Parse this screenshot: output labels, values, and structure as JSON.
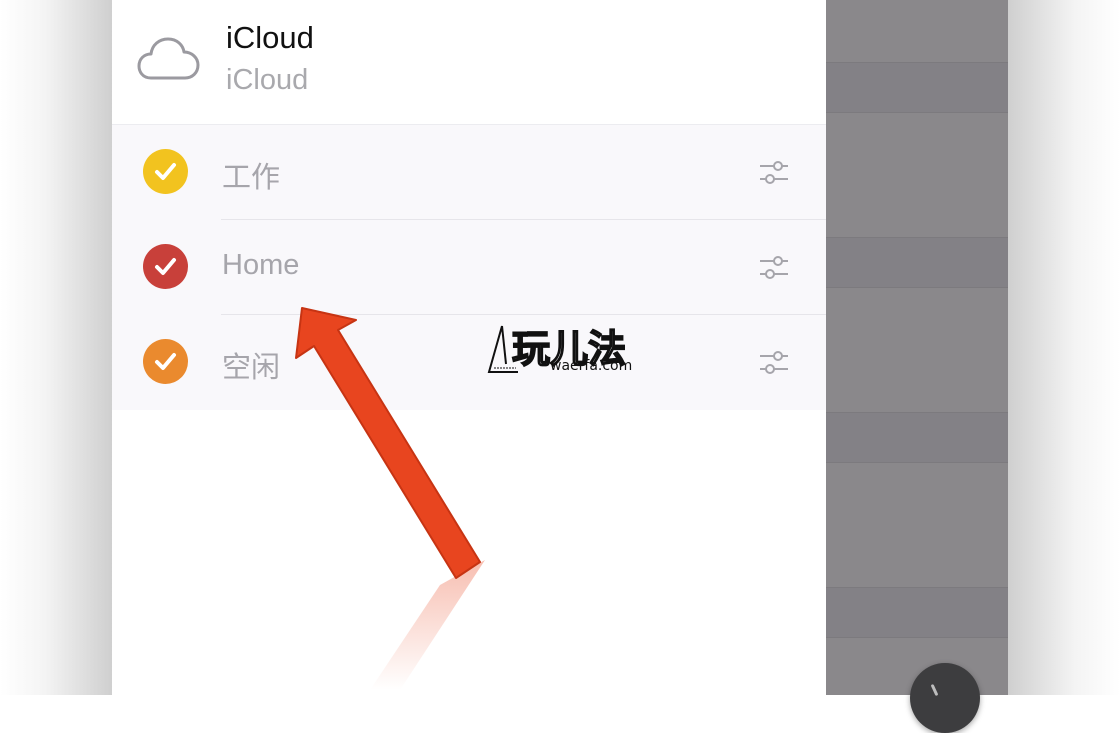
{
  "account": {
    "title": "iCloud",
    "subtitle": "iCloud",
    "icon": "cloud-icon"
  },
  "calendars": [
    {
      "label": "工作",
      "color": "#f2c31f",
      "checked": true
    },
    {
      "label": "Home",
      "color": "#c8403a",
      "checked": true
    },
    {
      "label": "空闲",
      "color": "#ea8a2e",
      "checked": true
    }
  ],
  "watermark": {
    "main": "玩儿法",
    "sub": "waerfa.com"
  },
  "colors": {
    "accent_arrow": "#e8451f",
    "overlay": "#8a888b"
  }
}
